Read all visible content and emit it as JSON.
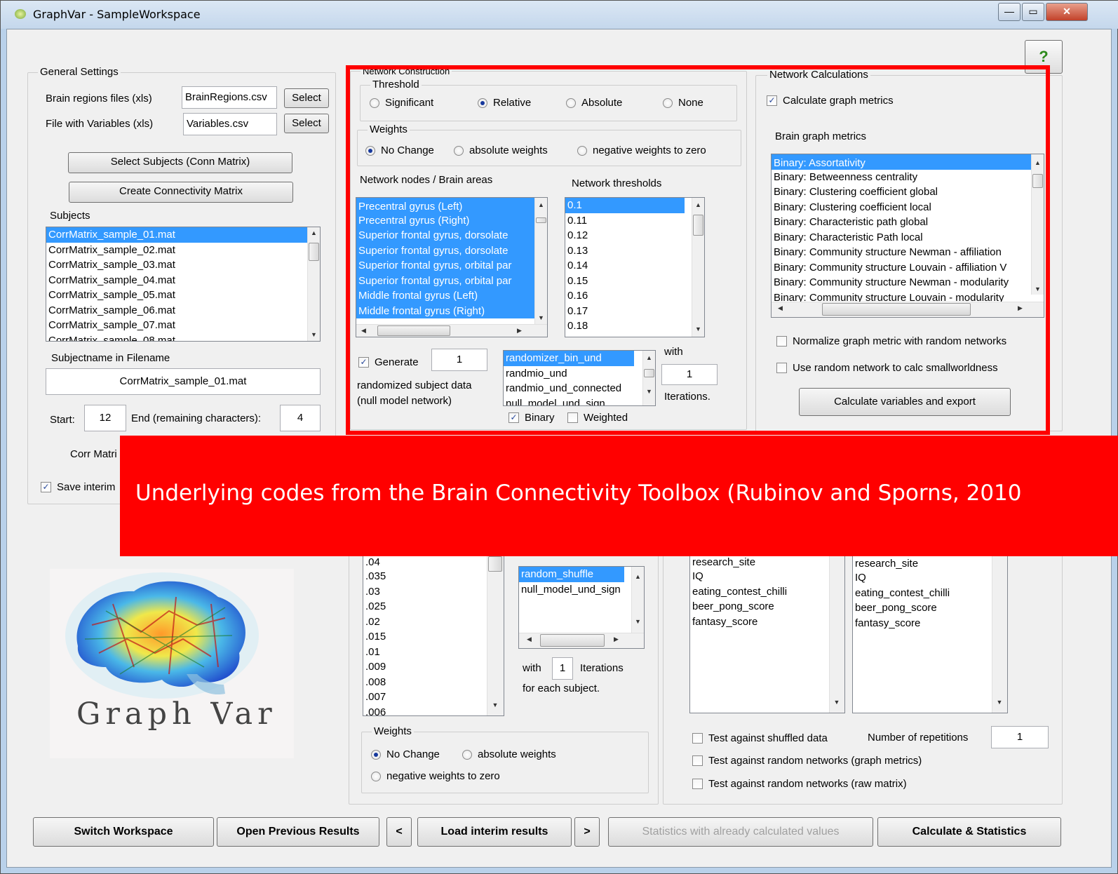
{
  "window": {
    "title": "GraphVar - SampleWorkspace",
    "min": "—",
    "max": "▭",
    "close": "✕"
  },
  "help": "?",
  "general": {
    "legend": "General Settings",
    "brain_regions_label": "Brain regions files (xls)",
    "brain_regions_value": "BrainRegions.csv",
    "variables_label": "File with Variables (xls)",
    "variables_value": "Variables.csv",
    "select": "Select",
    "select_subjects": "Select Subjects (Conn Matrix)",
    "create_matrix": "Create Connectivity Matrix",
    "subjects_label": "Subjects",
    "subjects": [
      "CorrMatrix_sample_01.mat",
      "CorrMatrix_sample_02.mat",
      "CorrMatrix_sample_03.mat",
      "CorrMatrix_sample_04.mat",
      "CorrMatrix_sample_05.mat",
      "CorrMatrix_sample_06.mat",
      "CorrMatrix_sample_07.mat",
      "CorrMatrix_sample_08.mat"
    ],
    "subjectname_label": "Subjectname in Filename",
    "subjectname_value": "CorrMatrix_sample_01.mat",
    "start_label": "Start:",
    "start_value": "12",
    "end_label": "End (remaining characters):",
    "end_value": "4",
    "corr_label": "Corr Matri",
    "save_interim": "Save interim"
  },
  "netcon": {
    "legend": "Network Construction",
    "threshold_legend": "Threshold",
    "threshold_options": [
      "Significant",
      "Relative",
      "Absolute",
      "None"
    ],
    "threshold_selected": "Relative",
    "weights_legend": "Weights",
    "weights_options": [
      "No Change",
      "absolute weights",
      "negative weights to zero"
    ],
    "nodes_label": "Network nodes / Brain areas",
    "nodes": [
      "Precentral gyrus (Left)",
      "Precentral gyrus (Right)",
      "Superior frontal gyrus, dorsolate",
      "Superior frontal gyrus, dorsolate",
      "Superior frontal gyrus, orbital par",
      "Superior frontal gyrus, orbital par",
      "Middle frontal gyrus (Left)",
      "Middle frontal gyrus (Right)"
    ],
    "thresholds_label": "Network thresholds",
    "thresholds": [
      "0.1",
      "0.11",
      "0.12",
      "0.13",
      "0.14",
      "0.15",
      "0.16",
      "0.17",
      "0.18"
    ],
    "generate_label": "Generate",
    "generate_value": "1",
    "randomized_label": "randomized subject data",
    "null_model_label": "(null model network)",
    "randomizers": [
      "randomizer_bin_und",
      "randmio_und",
      "randmio_und_connected",
      "null_model_und_sign"
    ],
    "with_label": "with",
    "iterations_value": "1",
    "iterations_label": "Iterations.",
    "binary_label": "Binary",
    "weighted_label": "Weighted"
  },
  "netcalc": {
    "legend": "Network Calculations",
    "calc_metrics": "Calculate graph metrics",
    "brain_metrics_label": "Brain graph metrics",
    "metrics": [
      "Binary: Assortativity",
      "Binary: Betweenness centrality",
      "Binary: Clustering coefficient global",
      "Binary: Clustering coefficient local",
      "Binary: Characteristic path global",
      "Binary: Characteristic Path local",
      "Binary: Community structure Newman - affiliation",
      "Binary: Community structure Louvain - affiliation V",
      "Binary: Community structure Newman - modularity",
      "Binary: Community structure Louvain - modularity"
    ],
    "normalize": "Normalize graph metric with random networks",
    "smallworld": "Use random network to calc smallworldness",
    "calc_export": "Calculate variables and export"
  },
  "banner": "Underlying codes from the Brain Connectivity Toolbox (Rubinov and Sporns, 2010",
  "lower": {
    "pvalues": [
      ".04",
      ".035",
      ".03",
      ".025",
      ".02",
      ".015",
      ".01",
      ".009",
      ".008",
      ".007",
      ".006"
    ],
    "shuffle_items": [
      "random_shuffle",
      "null_model_und_sign"
    ],
    "with_label": "with",
    "iter_value": "1",
    "iterations_label": "Iterations",
    "for_each": "for each subject.",
    "weights_legend": "Weights",
    "no_change": "No Change",
    "absolute": "absolute weights",
    "negative": "negative weights to zero",
    "vars_a": [
      "research_site",
      "IQ",
      "eating_contest_chilli",
      "beer_pong_score",
      "fantasy_score"
    ],
    "vars_b": [
      "research_site",
      "IQ",
      "eating_contest_chilli",
      "beer_pong_score",
      "fantasy_score"
    ],
    "test_shuffled": "Test against shuffled data",
    "repetitions_label": "Number of repetitions",
    "repetitions_value": "1",
    "test_random_graph": "Test against random networks (graph metrics)",
    "test_random_raw": "Test against random networks (raw matrix)"
  },
  "logo_text": "Graph Var",
  "bottom": {
    "switch": "Switch Workspace",
    "open_prev": "Open Previous Results",
    "prev": "<",
    "load_interim": "Load interim results",
    "next": ">",
    "stats_calc": "Statistics with already calculated values",
    "calc_stats": "Calculate & Statistics"
  }
}
